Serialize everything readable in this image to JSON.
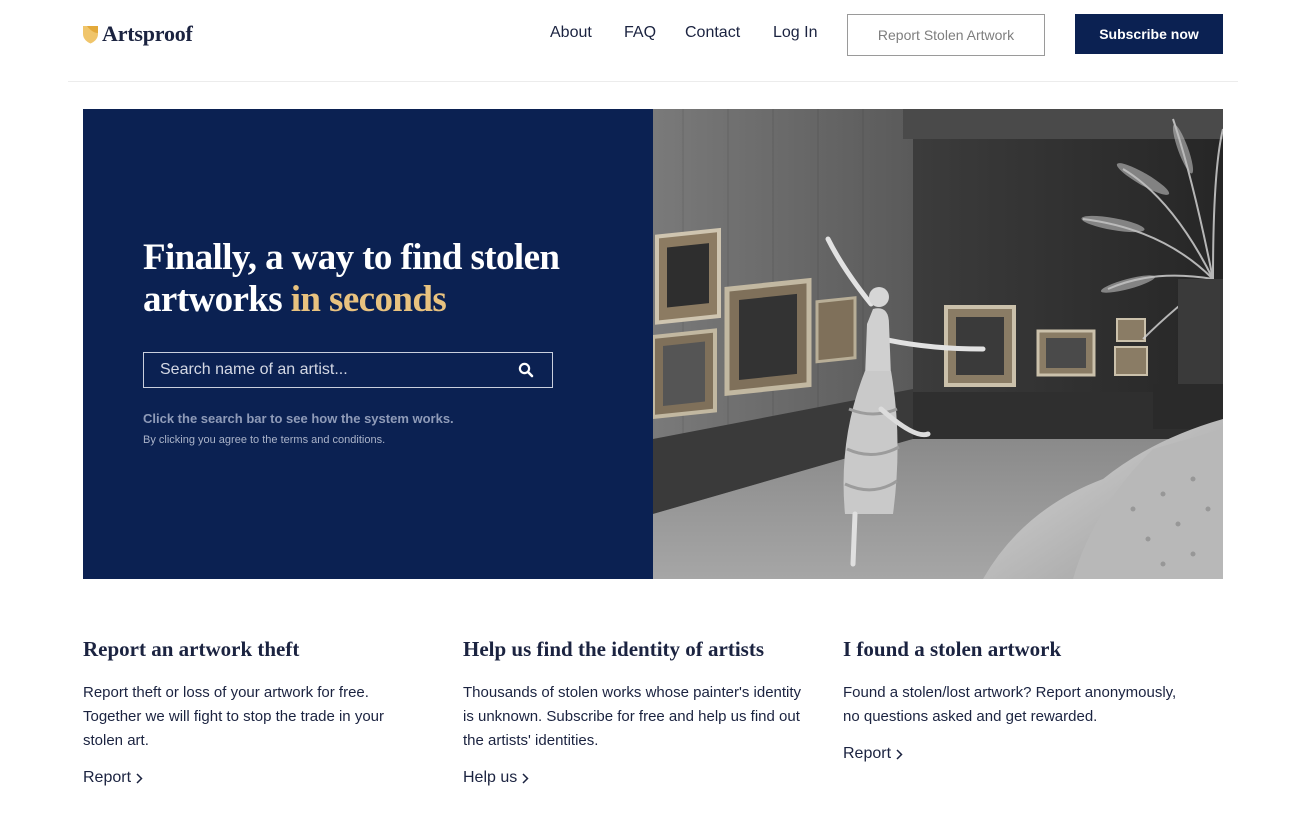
{
  "brand": {
    "name": "Artsproof",
    "accent_color": "#e8c27f",
    "primary_color": "#0b2152"
  },
  "nav": {
    "items": [
      {
        "label": "About"
      },
      {
        "label": "FAQ"
      },
      {
        "label": "Contact"
      },
      {
        "label": "Log In"
      }
    ],
    "report_button": "Report Stolen Artwork",
    "subscribe_button": "Subscribe now"
  },
  "hero": {
    "title_main": "Finally, a way to find stolen artworks ",
    "title_accent": "in seconds",
    "search": {
      "placeholder": "Search name of an artist...",
      "value": "",
      "icon": "search-icon"
    },
    "hint": "Click the search bar to see how the system works.",
    "terms": "By clicking you agree to the terms and conditions."
  },
  "features": [
    {
      "title": "Report an artwork theft",
      "body": "Report theft or loss of your artwork for free. Together we will fight to stop the trade in your stolen art.",
      "link": "Report"
    },
    {
      "title": "Help us find the identity of artists",
      "body": "Thousands of stolen works whose painter's identity is unknown. Subscribe for free and help us find out the artists' identities.",
      "link": "Help us"
    },
    {
      "title": "I found a stolen artwork",
      "body": "Found a stolen/lost artwork? Report anonymously, no questions asked and get rewarded.",
      "link": "Report"
    }
  ]
}
